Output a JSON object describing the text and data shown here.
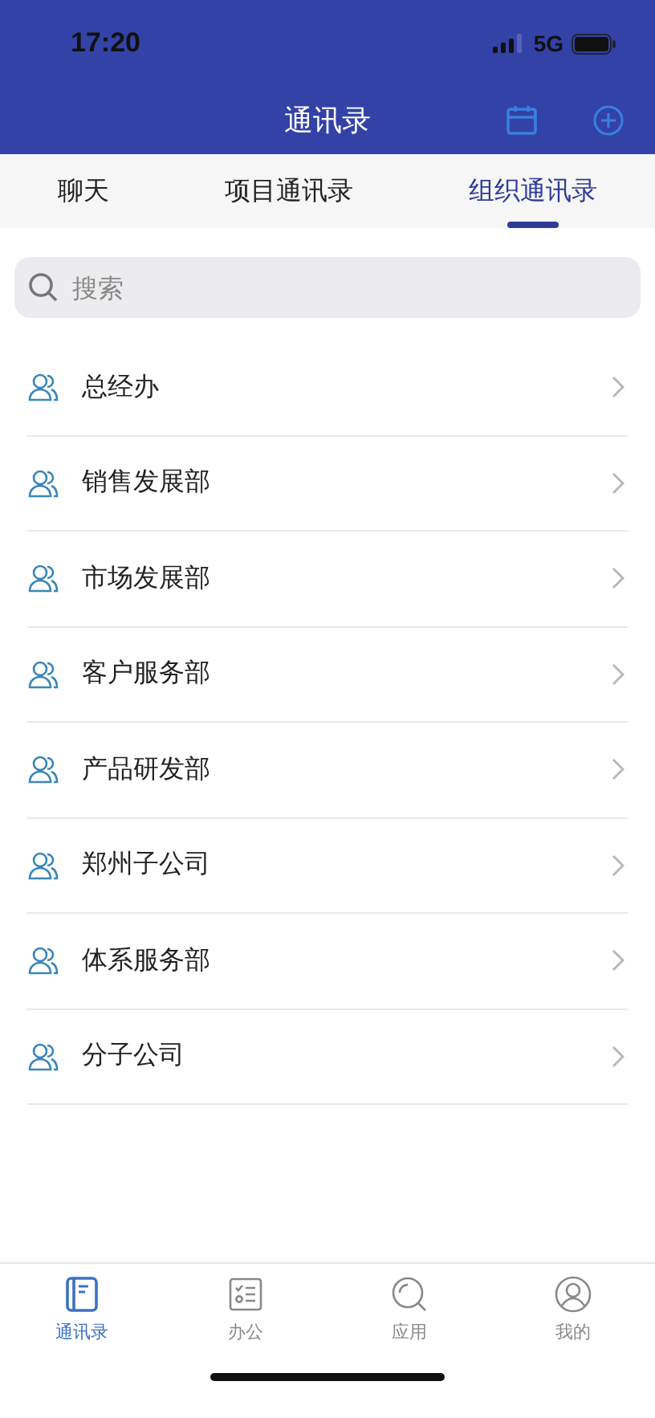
{
  "status_bar": {
    "time": "17:20",
    "network": "5G"
  },
  "header": {
    "title": "通讯录"
  },
  "tabs": [
    {
      "label": "聊天",
      "selected": false
    },
    {
      "label": "项目通讯录",
      "selected": false
    },
    {
      "label": "组织通讯录",
      "selected": true
    }
  ],
  "search": {
    "placeholder": "搜索"
  },
  "departments": [
    {
      "name": "总经办"
    },
    {
      "name": "销售发展部"
    },
    {
      "name": "市场发展部"
    },
    {
      "name": "客户服务部"
    },
    {
      "name": "产品研发部"
    },
    {
      "name": "郑州子公司"
    },
    {
      "name": "体系服务部"
    },
    {
      "name": "分子公司"
    }
  ],
  "tab_bar": [
    {
      "label": "通讯录",
      "kind": "contacts",
      "selected": true
    },
    {
      "label": "办公",
      "kind": "office",
      "selected": false
    },
    {
      "label": "应用",
      "kind": "apps",
      "selected": false
    },
    {
      "label": "我的",
      "kind": "me",
      "selected": false
    }
  ]
}
